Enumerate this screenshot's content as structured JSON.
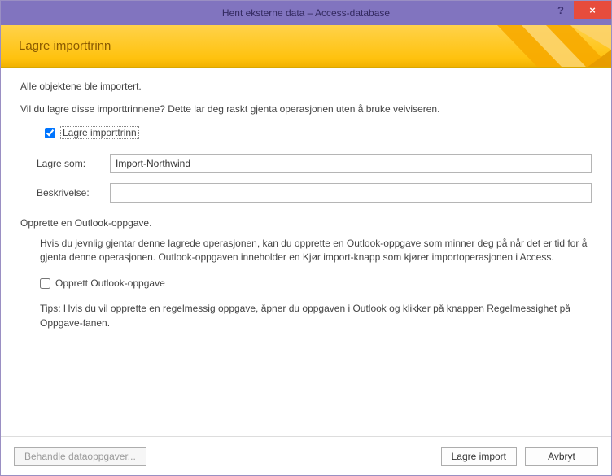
{
  "titlebar": {
    "title": "Hent eksterne data – Access-database",
    "help_tooltip": "?",
    "close_tooltip": "×"
  },
  "banner": {
    "heading": "Lagre importtrinn"
  },
  "content": {
    "status": "Alle objektene ble importert.",
    "prompt": "Vil du lagre disse importtrinnene? Dette lar deg raskt gjenta operasjonen uten å bruke veiviseren.",
    "save_steps_label": "Lagre importtrinn",
    "save_steps_checked": true,
    "save_as_label": "Lagre som:",
    "save_as_value": "Import-Northwind",
    "description_label": "Beskrivelse:",
    "description_value": "",
    "outlook_heading": "Opprette en Outlook-oppgave.",
    "outlook_body": "Hvis du jevnlig gjentar denne lagrede operasjonen, kan du opprette en Outlook-oppgave som minner deg på når det er tid for å gjenta denne operasjonen. Outlook-oppgaven inneholder en Kjør import-knapp som kjører importoperasjonen i Access.",
    "outlook_checkbox_label": "Opprett Outlook-oppgave",
    "outlook_checkbox_checked": false,
    "tips": "Tips: Hvis du vil opprette en regelmessig oppgave, åpner du oppgaven i Outlook og klikker på knappen Regelmessighet på Oppgave-fanen."
  },
  "footer": {
    "manage_label": "Behandle dataoppgaver...",
    "save_label": "Lagre import",
    "cancel_label": "Avbryt"
  }
}
